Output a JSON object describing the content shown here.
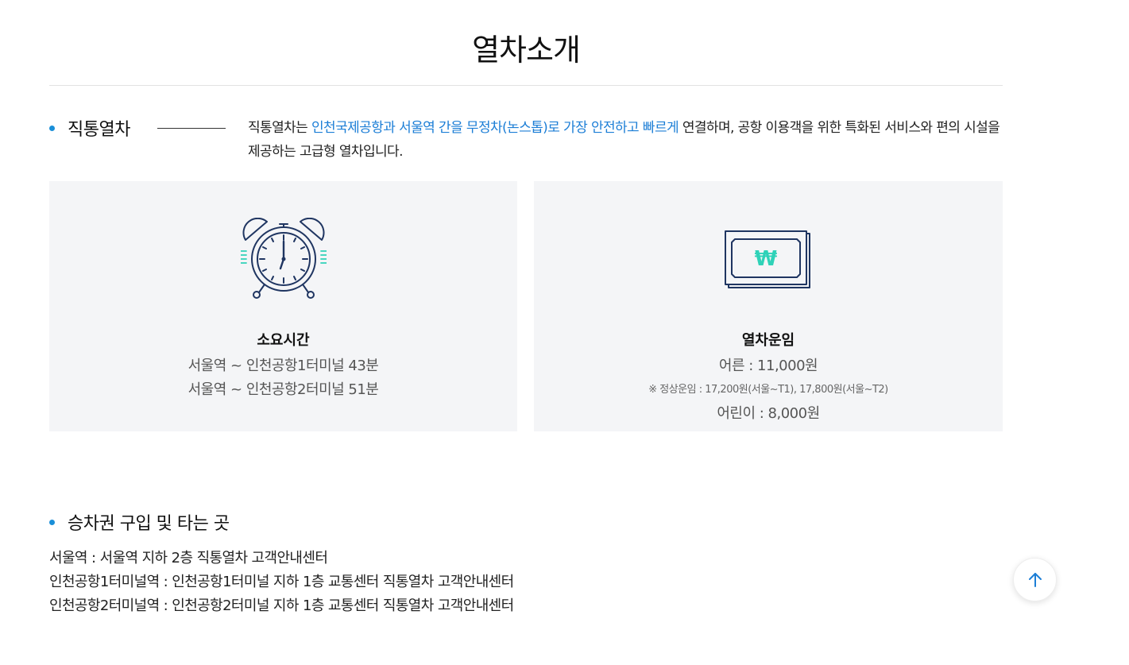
{
  "page": {
    "title": "열차소개"
  },
  "express": {
    "heading": "직통열차",
    "intro": {
      "prefix": "직통열차는 ",
      "highlight": "인천국제공항과 서울역 간을 무정차(논스톱)로 가장 안전하고 빠르게",
      "suffix": " 연결하며, 공항 이용객을 위한 특화된 서비스와 편의 시설을 제공하는 고급형 열차입니다."
    }
  },
  "cards": {
    "time": {
      "icon": "alarm-clock-icon",
      "title": "소요시간",
      "lines": [
        "서울역 ~ 인천공항1터미널 43분",
        "서울역 ~ 인천공항2터미널 51분"
      ]
    },
    "fare": {
      "icon": "won-banknote-icon",
      "currency_symbol": "₩",
      "title": "열차운임",
      "adult": "어른 : 11,000원",
      "note": "※ 정상운임 : 17,200원(서울~T1), 17,800원(서울~T2)",
      "child": "어린이 : 8,000원"
    }
  },
  "tickets": {
    "heading": "승차권 구입 및 타는 곳",
    "locations": [
      "서울역 : 서울역 지하 2층 직통열차 고객안내센터",
      "인천공항1터미널역 : 인천공항1터미널 지하 1층 교통센터 직통열차 고객안내센터",
      "인천공항2터미널역 : 인천공항2터미널 지하 1층 교통센터 직통열차 고객안내센터"
    ]
  },
  "scroll_top": {
    "icon": "arrow-up-icon"
  },
  "colors": {
    "accent": "#1c7ed6",
    "bullet": "#1a8fd8",
    "icon_navy": "#1f3561",
    "icon_mint": "#2fd2b8",
    "card_bg": "#f4f5f7"
  }
}
